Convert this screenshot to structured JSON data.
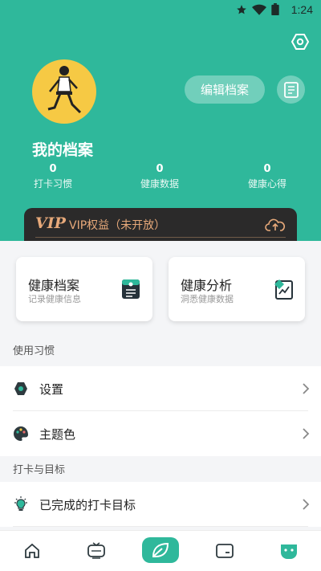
{
  "status_bar": {
    "time": "1:24"
  },
  "header": {
    "background": "#2fb89b",
    "edit_profile_label": "编辑档案",
    "title": "我的档案",
    "stats": [
      {
        "value": "0",
        "label": "打卡习惯"
      },
      {
        "value": "0",
        "label": "健康数据"
      },
      {
        "value": "0",
        "label": "健康心得"
      }
    ]
  },
  "vip": {
    "badge": "VIP",
    "text": "VIP权益（未开放）",
    "accent": "#e7a97a"
  },
  "cards": [
    {
      "title": "健康档案",
      "subtitle": "记录健康信息",
      "icon": "health-record-icon"
    },
    {
      "title": "健康分析",
      "subtitle": "洞悉健康数据",
      "icon": "health-analysis-icon"
    }
  ],
  "sections": [
    {
      "title": "使用习惯",
      "items": [
        {
          "label": "设置",
          "icon": "settings-icon"
        },
        {
          "label": "主题色",
          "icon": "palette-icon"
        }
      ]
    },
    {
      "title": "打卡与目标",
      "items": [
        {
          "label": "已完成的打卡目标",
          "icon": "lightbulb-icon"
        }
      ]
    }
  ],
  "tabbar": {
    "tabs": [
      "home-icon",
      "tv-icon",
      "leaf-icon",
      "wallet-icon",
      "profile-face-icon"
    ],
    "active_index": 2
  }
}
